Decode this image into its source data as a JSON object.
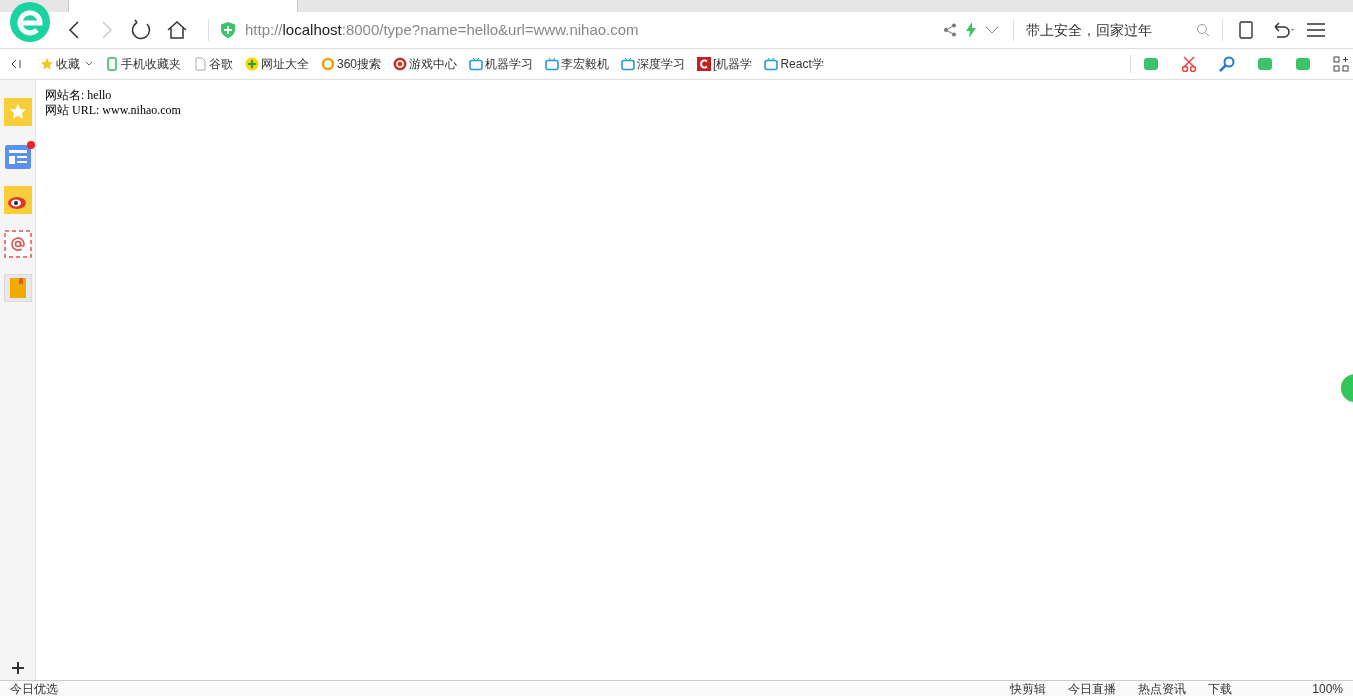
{
  "address_bar": {
    "url_prefix": "http://",
    "url_host": "localhost",
    "url_rest": ":8000/type?name=hello&url=www.nihao.com"
  },
  "search": {
    "value": "带上安全，回家过年"
  },
  "bookmarks": [
    {
      "kind": "star",
      "label": "收藏"
    },
    {
      "kind": "phone",
      "label": "手机收藏夹"
    },
    {
      "kind": "page",
      "label": "谷歌"
    },
    {
      "kind": "plus",
      "label": "网址大全"
    },
    {
      "kind": "ring",
      "label": "360搜索"
    },
    {
      "kind": "game",
      "label": "游戏中心"
    },
    {
      "kind": "tv",
      "label": "机器学习"
    },
    {
      "kind": "tv",
      "label": "李宏毅机"
    },
    {
      "kind": "tv",
      "label": "深度学习"
    },
    {
      "kind": "c",
      "label": "[机器学"
    },
    {
      "kind": "tv",
      "label": "React学"
    }
  ],
  "sidebar": [
    {
      "kind": "star",
      "badge": false
    },
    {
      "kind": "news",
      "badge": true
    },
    {
      "kind": "weibo",
      "badge": false
    },
    {
      "kind": "mail",
      "badge": false
    },
    {
      "kind": "book",
      "badge": false
    }
  ],
  "page": {
    "lines": [
      "网站名: hello",
      "网站 URL: www.nihao.com"
    ]
  },
  "status_bar": {
    "left": "今日优选",
    "items": [
      "快剪辑",
      "今日直播",
      "热点资讯",
      "下载"
    ],
    "zoom": "100%"
  }
}
